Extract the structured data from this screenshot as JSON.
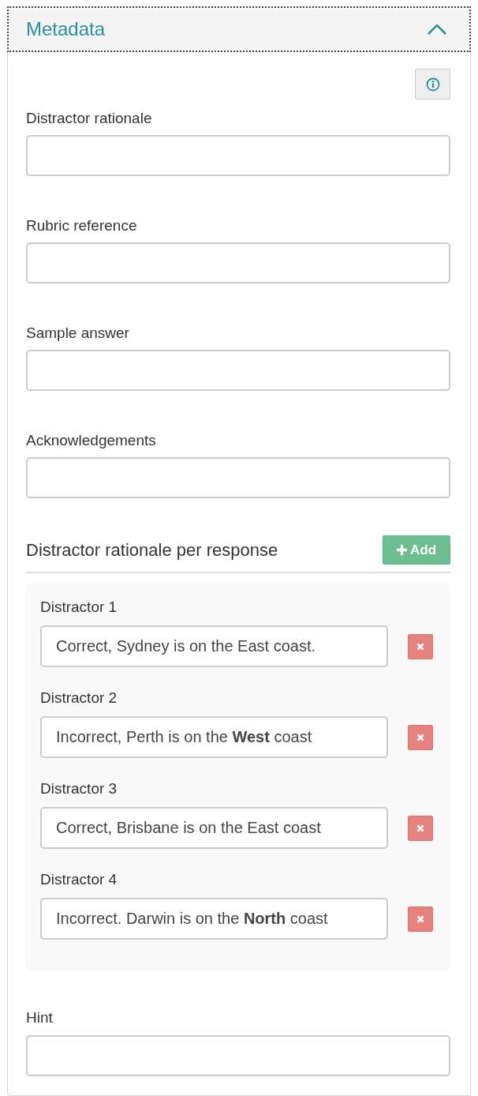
{
  "panel": {
    "title": "Metadata",
    "expanded": true
  },
  "fields": [
    {
      "label": "Distractor rationale"
    },
    {
      "label": "Rubric reference"
    },
    {
      "label": "Sample answer"
    },
    {
      "label": "Acknowledgements"
    }
  ],
  "distractor_section": {
    "heading": "Distractor rationale per response",
    "add_button": "Add",
    "items": [
      {
        "label": "Distractor 1",
        "value": "Correct, Sydney is on the East coast."
      },
      {
        "label": "Distractor 2",
        "value": "Incorrect, Perth is on the **West** coast"
      },
      {
        "label": "Distractor 3",
        "value": "Correct, Brisbane is on the East coast"
      },
      {
        "label": "Distractor 4",
        "value": "Incorrect. Darwin is on the **North** coast"
      }
    ]
  },
  "hint": {
    "label": "Hint"
  }
}
